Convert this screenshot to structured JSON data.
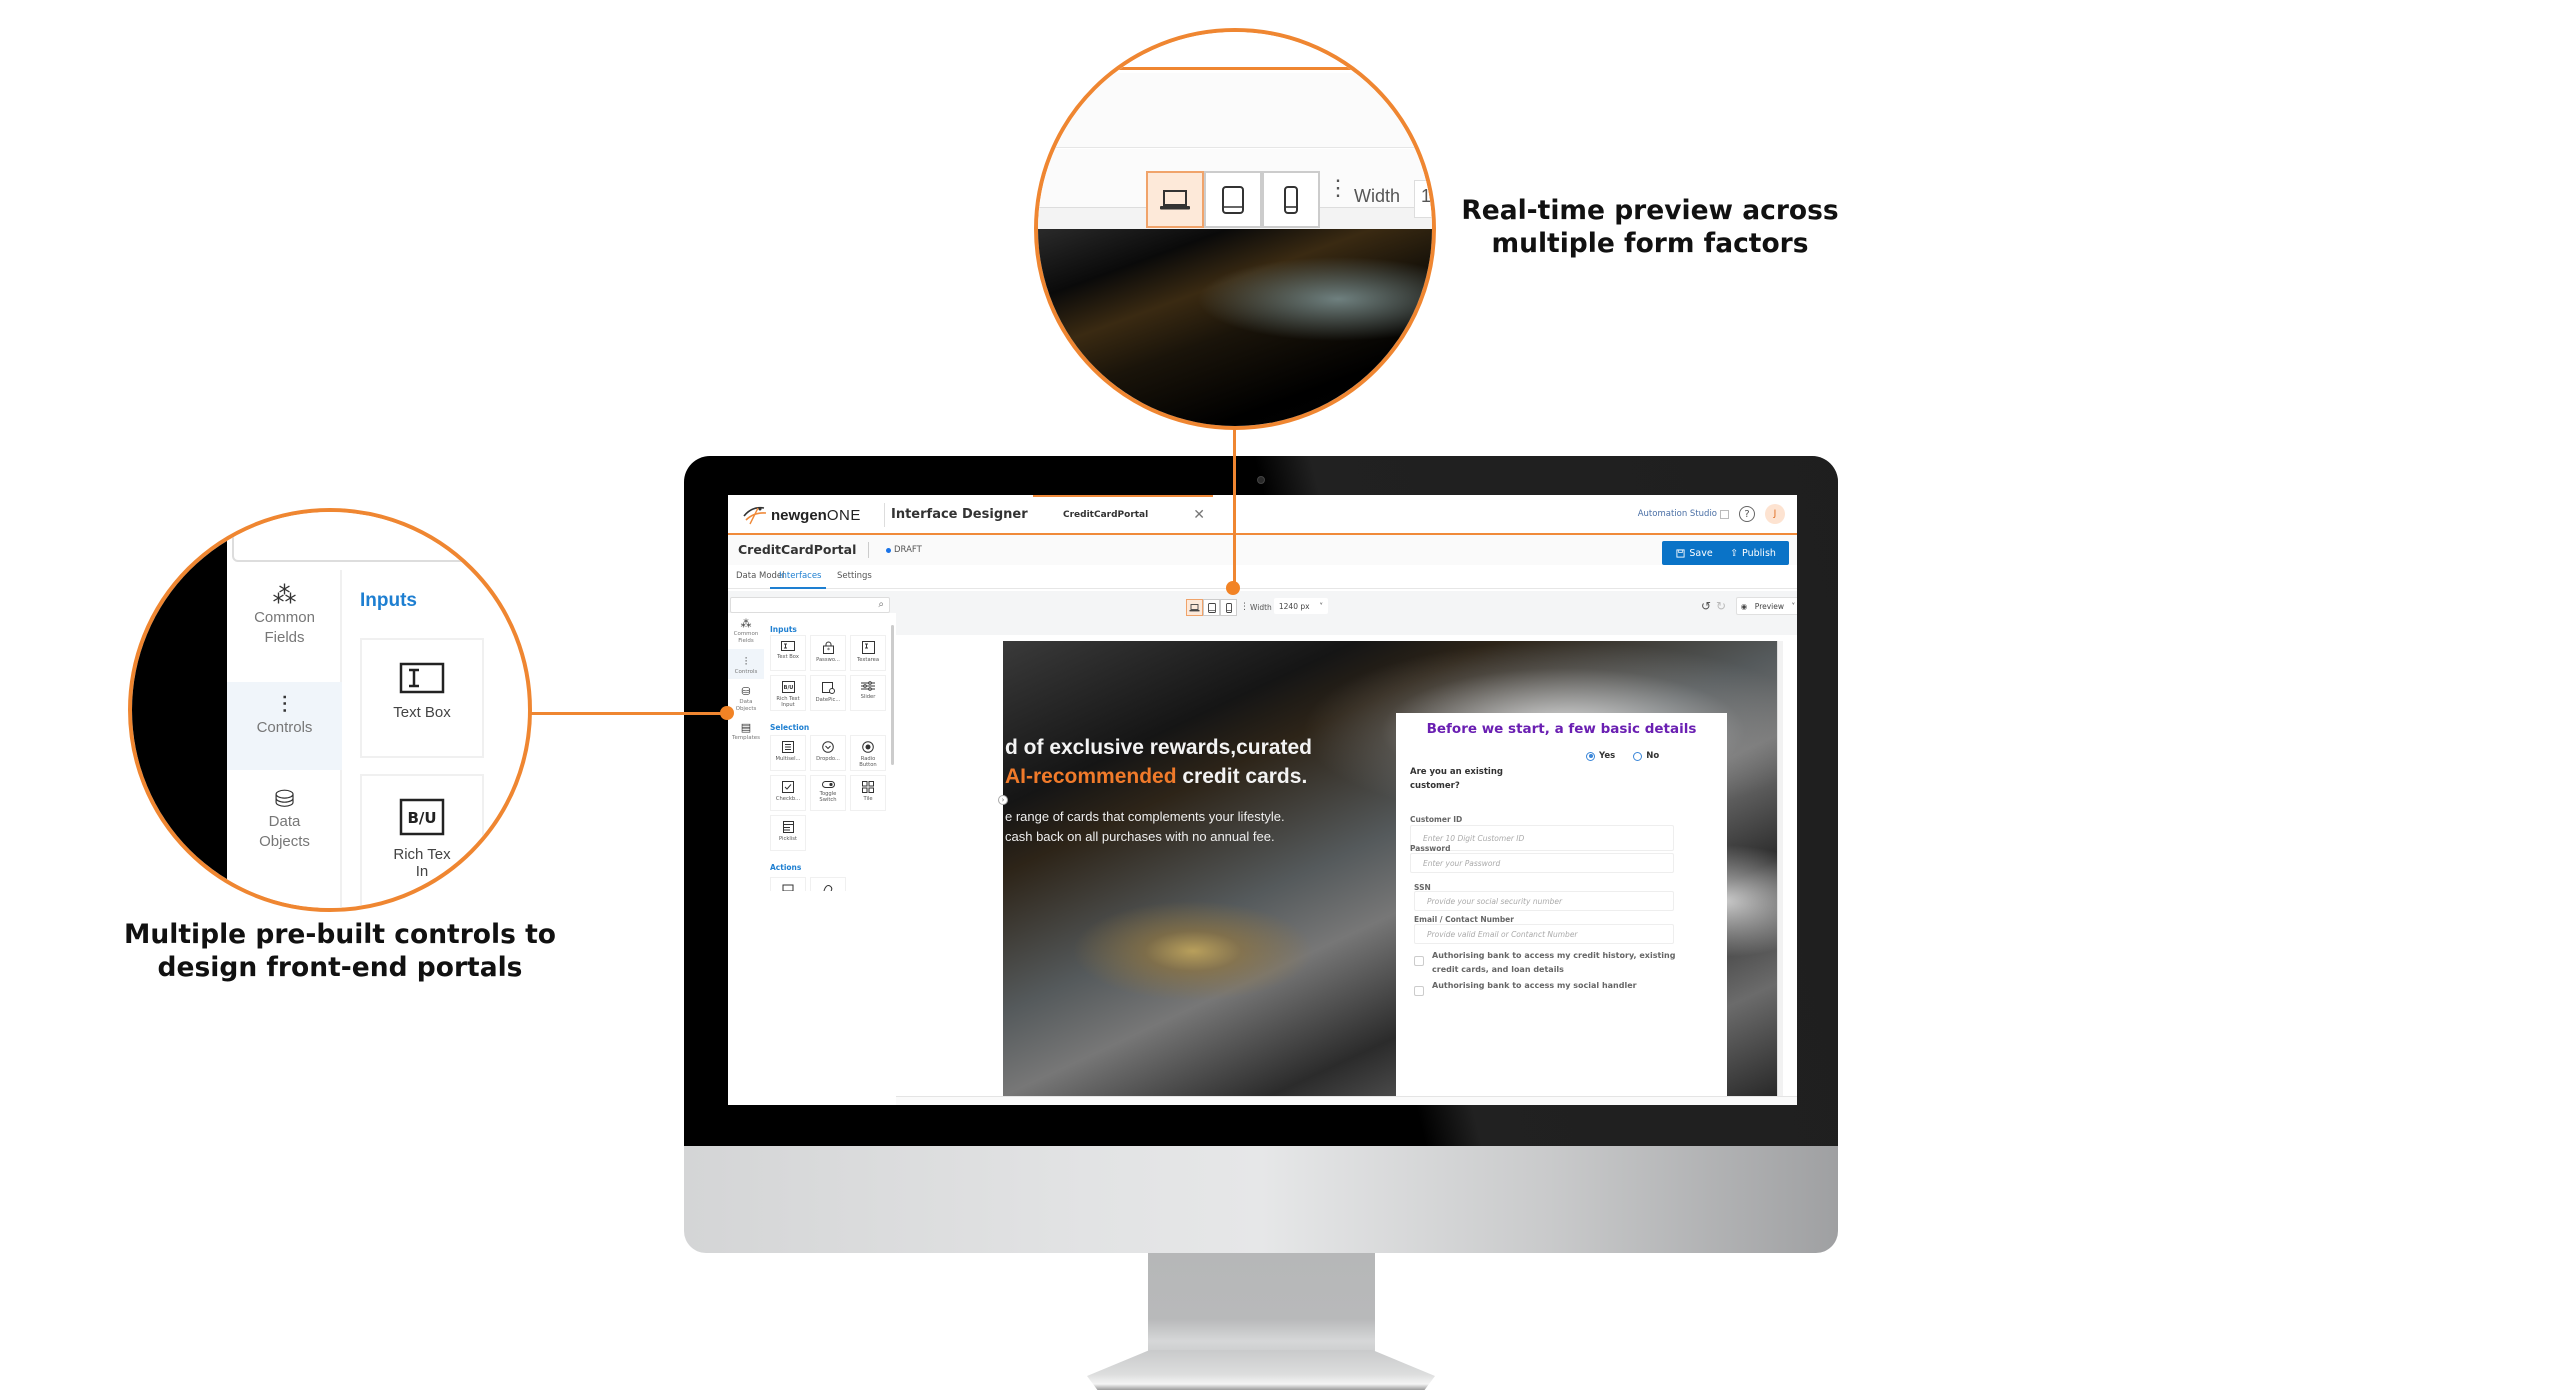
{
  "callouts": {
    "left": {
      "text_line1": "Multiple pre-built controls to",
      "text_line2": "design front-end portals"
    },
    "top": {
      "text_line1": "Real-time preview across",
      "text_line2": "multiple form factors"
    },
    "accent_color": "#ef8631"
  },
  "zoom_left": {
    "rail": [
      {
        "icon": "common-fields-icon",
        "glyph": "⁂",
        "label_line1": "Common",
        "label_line2": "Fields"
      },
      {
        "icon": "controls-icon",
        "glyph": "⫶",
        "label_line1": "Controls",
        "label_line2": ""
      },
      {
        "icon": "data-objects-icon",
        "glyph": "⛁",
        "label_line1": "Data",
        "label_line2": "Objects"
      }
    ],
    "section": "Inputs",
    "controls": [
      {
        "label": "Text Box"
      },
      {
        "label": "Rich Tex",
        "label2": "In"
      }
    ]
  },
  "zoom_top": {
    "width_label": "Width",
    "width_value": "1"
  },
  "app": {
    "brand_bold": "newgen",
    "brand_light": "ONE",
    "title": "Interface Designer",
    "doc_tab": "CreditCardPortal",
    "close_glyph": "✕",
    "automation_studio": "Automation Studio",
    "help_glyph": "?",
    "avatar_initial": "J",
    "project_name": "CreditCardPortal",
    "status": "DRAFT",
    "save_label": "Save",
    "publish_label": "Publish",
    "tabs": [
      {
        "label": "Data Model"
      },
      {
        "label": "Interfaces"
      },
      {
        "label": "Settings"
      }
    ],
    "active_tab": "Interfaces",
    "brand_color": "#0a73c7"
  },
  "toolbar": {
    "width_label": "Width",
    "width_value": "1240 px",
    "preview_label": "Preview",
    "active_device": "desktop",
    "devices": [
      "desktop",
      "tablet",
      "mobile"
    ]
  },
  "palette": {
    "search_placeholder": "",
    "categories": [
      {
        "label1": "Common",
        "label2": "Fields",
        "glyph": "⁂"
      },
      {
        "label1": "Controls",
        "label2": "",
        "glyph": "⫶"
      },
      {
        "label1": "Data",
        "label2": "Objects",
        "glyph": "⛁"
      },
      {
        "label1": "Templates",
        "label2": "",
        "glyph": "▤"
      }
    ],
    "active_category": "Controls",
    "sections": {
      "inputs": "Inputs",
      "selection": "Selection",
      "actions": "Actions"
    },
    "inputs": [
      {
        "label": "Text Box",
        "label2": ""
      },
      {
        "label": "Passwo...",
        "label2": ""
      },
      {
        "label": "Textarea",
        "label2": ""
      },
      {
        "label": "Rich Text",
        "label2": "Input"
      },
      {
        "label": "DatePic...",
        "label2": ""
      },
      {
        "label": "Slider",
        "label2": ""
      }
    ],
    "selection": [
      {
        "label": "Multisel...",
        "label2": ""
      },
      {
        "label": "Dropdo...",
        "label2": ""
      },
      {
        "label": "Radio",
        "label2": "Button"
      },
      {
        "label": "Checkb...",
        "label2": ""
      },
      {
        "label": "Toggle",
        "label2": "Switch"
      },
      {
        "label": "Tile",
        "label2": ""
      },
      {
        "label": "Picklist",
        "label2": ""
      }
    ]
  },
  "canvas": {
    "hero_line1": "d of exclusive rewards,curated",
    "hero_line2_accent": "AI-recommended",
    "hero_line2_rest": " credit cards.",
    "hero_p1": "e range of cards that complements your lifestyle.",
    "hero_p2": "cash back on all purchases with no annual fee.",
    "form": {
      "title": "Before we start, a few basic details",
      "question": "Are you an existing customer?",
      "options": [
        {
          "label": "Yes",
          "selected": true
        },
        {
          "label": "No",
          "selected": false
        }
      ],
      "fields": [
        {
          "label": "Customer ID",
          "placeholder": "Enter 10 Digit Customer ID"
        },
        {
          "label": "Password",
          "placeholder": "Enter your Password"
        },
        {
          "label": "SSN",
          "placeholder": "Provide your social security number"
        },
        {
          "label": "Email / Contact Number",
          "placeholder": "Provide valid Email or Contanct Number"
        }
      ],
      "checkboxes": [
        {
          "label": "Authorising bank to access my credit history, existing credit cards, and loan details",
          "checked": false
        },
        {
          "label": "Authorising bank to access my social handler",
          "checked": false
        }
      ],
      "title_color": "#6a1fb2"
    }
  }
}
